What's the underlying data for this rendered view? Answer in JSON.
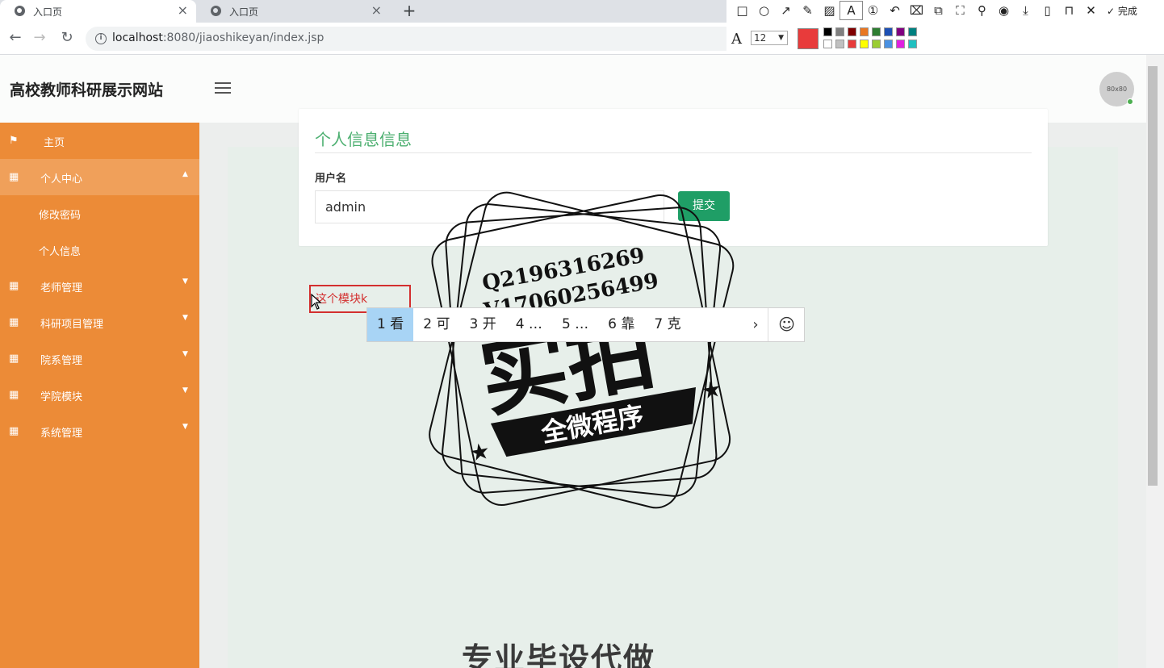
{
  "browser": {
    "tabs": [
      {
        "title": "入口页",
        "active": true
      },
      {
        "title": "入口页",
        "active": false
      }
    ],
    "new_tab": "+",
    "url_host": "localhost",
    "url_path": ":8080/jiaoshikeyan/index.jsp"
  },
  "snip_tool": {
    "done_label": "完成",
    "font_size": "12",
    "current_color": "#e83b3b",
    "palette": [
      "#000000",
      "#808080",
      "#800000",
      "#e87722",
      "#2e7d32",
      "#1e50b4",
      "#800080",
      "#008080",
      "#ffffff",
      "#c0c0c0",
      "#e83b3b",
      "#ffff00",
      "#9acd32",
      "#4a90e2",
      "#e020e0",
      "#20c0c0"
    ]
  },
  "app": {
    "site_title": "高校教师科研展示网站",
    "avatar_text": "80x80",
    "sidebar": {
      "home": "主页",
      "personal_center": "个人中心",
      "sub_change_password": "修改密码",
      "sub_personal_info": "个人信息",
      "teacher_mgmt": "老师管理",
      "project_mgmt": "科研项目管理",
      "department_mgmt": "院系管理",
      "college_module": "学院模块",
      "system_mgmt": "系统管理"
    },
    "card": {
      "title": "个人信息信息",
      "username_label": "用户名",
      "username_value": "admin",
      "submit_label": "提交"
    }
  },
  "annotation_text": "这个模块k",
  "ime_candidates": [
    "1 看",
    "2 可",
    "3 开",
    "4 …",
    "5 …",
    "6 靠",
    "7 克"
  ],
  "watermark": {
    "line1": "Q2196316269",
    "line2": "V17060256499",
    "main": "实拍",
    "banner": "全微程序",
    "footer": "专业毕设代做"
  }
}
